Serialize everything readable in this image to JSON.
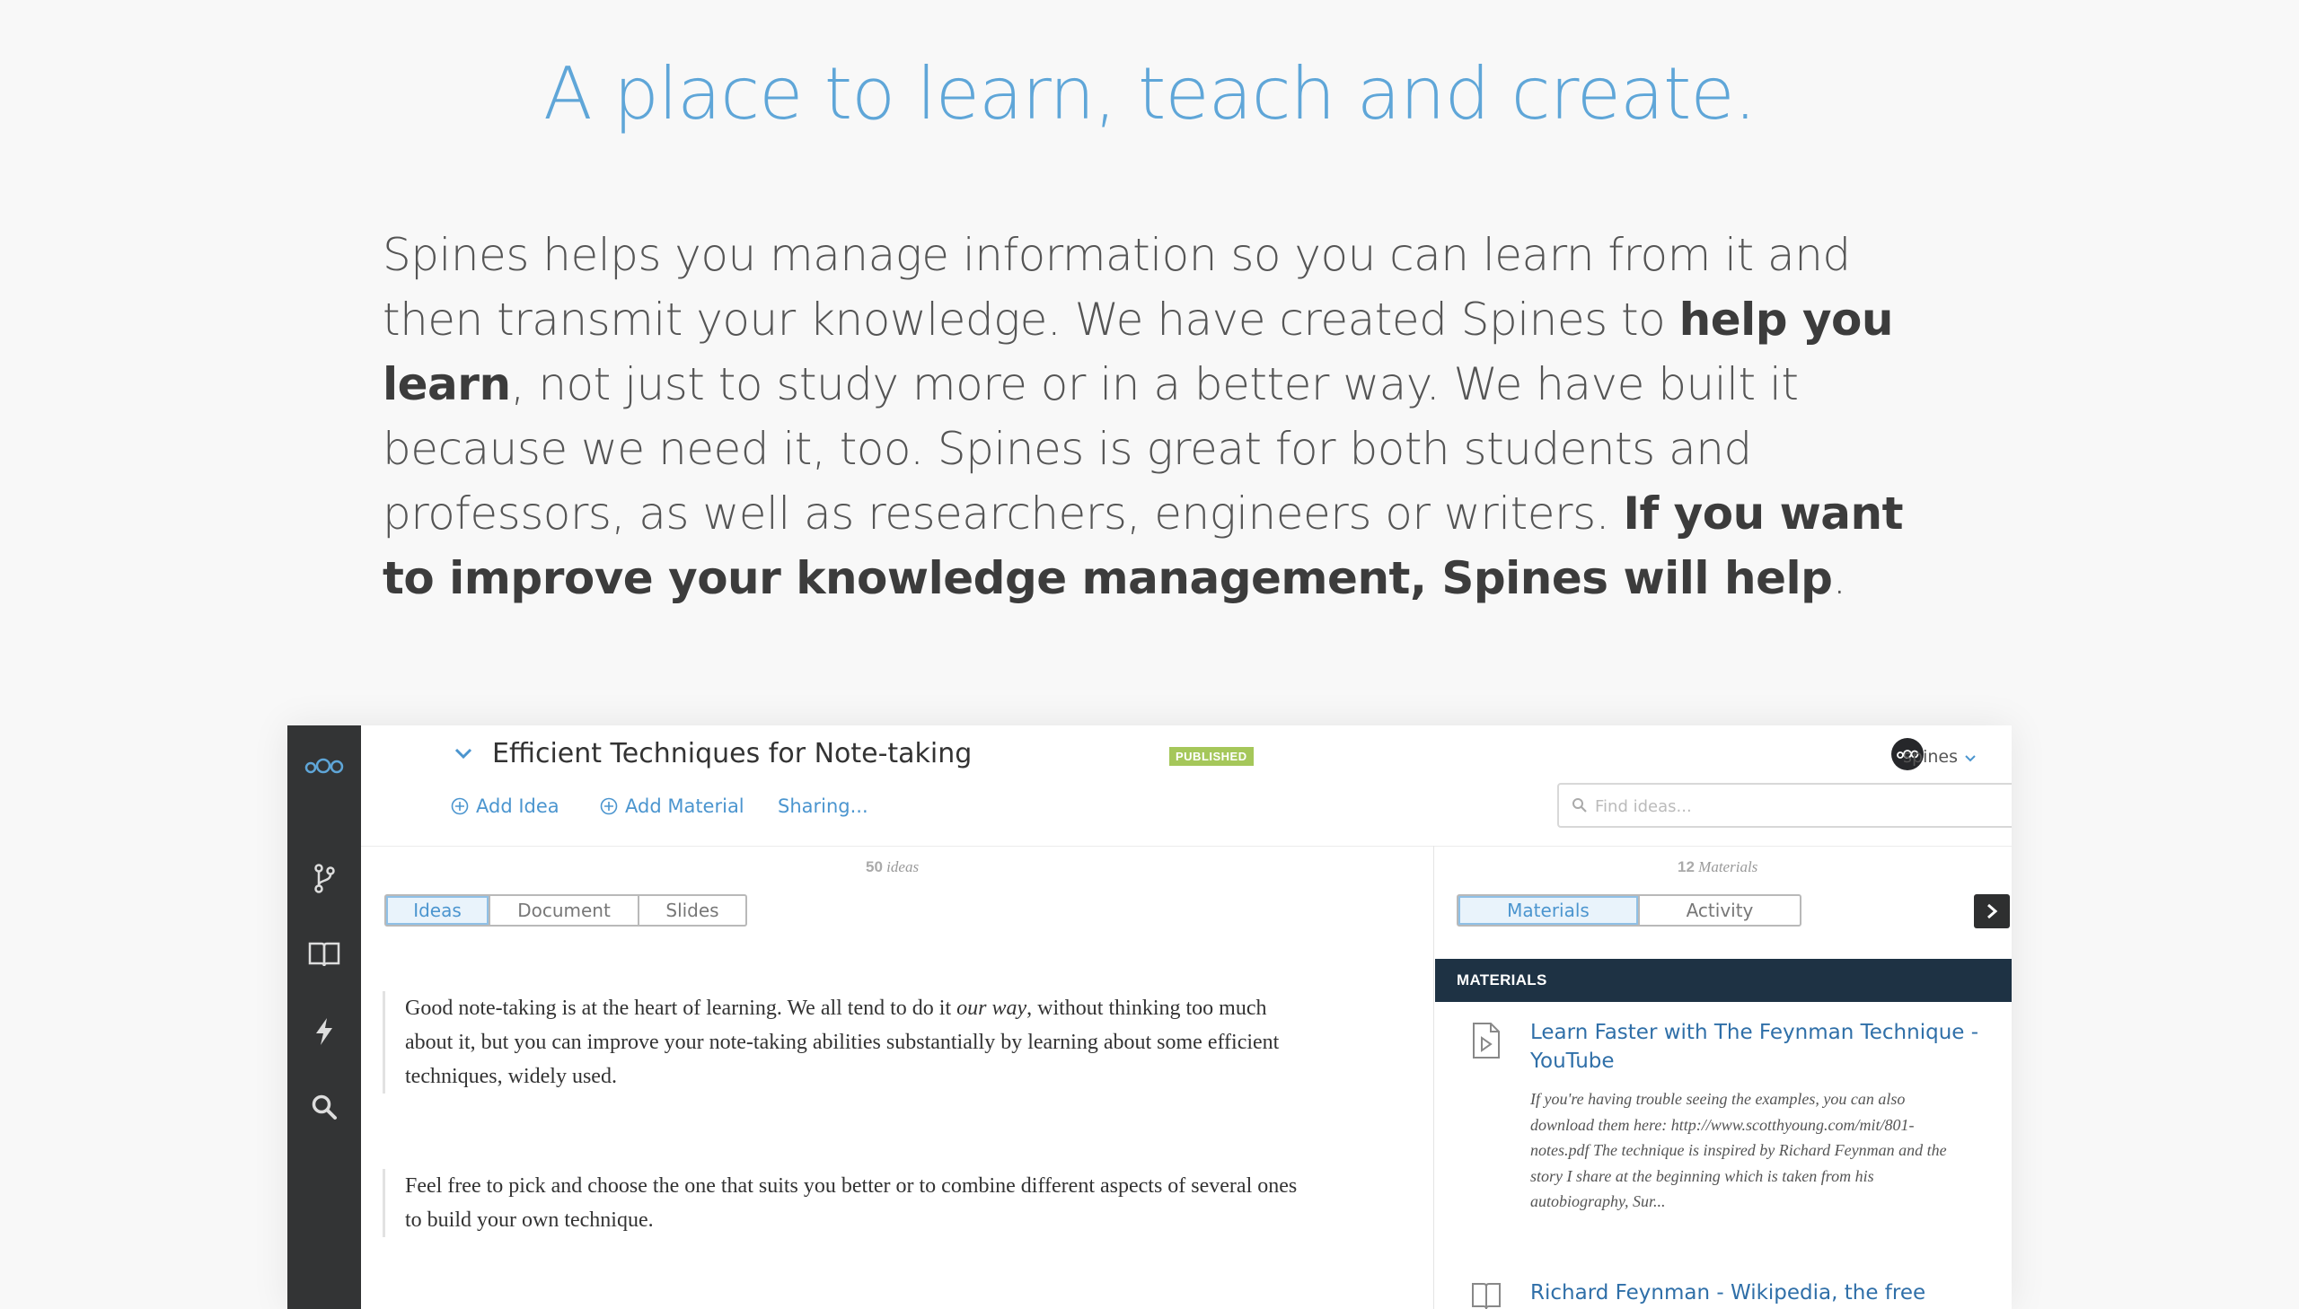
{
  "hero": {
    "headline": "A place to learn, teach and create.",
    "intro_1": "Spines helps you manage information so you can learn from it and then transmit your knowledge. We have created Spines to ",
    "intro_bold_1": "help you learn",
    "intro_2": ", not just to study more or in a better way. We have built it because we need it, too. Spines is great for both students and professors, as well as researchers, engineers or writers. ",
    "intro_bold_2": "If you want to improve your knowledge management, Spines will help",
    "intro_3": "."
  },
  "app": {
    "sidebar": {
      "icons": [
        "spines-logo-icon",
        "branch-icon",
        "book-icon",
        "bolt-icon",
        "search-icon"
      ]
    },
    "header": {
      "title": "Efficient Techniques for Note-taking",
      "badge": "PUBLISHED",
      "user_name": "spines"
    },
    "actions": {
      "add_idea": "Add Idea",
      "add_material": "Add Material",
      "sharing": "Sharing..."
    },
    "search": {
      "placeholder": "Find ideas..."
    },
    "ideas_panel": {
      "count_number": "50",
      "count_unit": "ideas",
      "tabs": [
        "Ideas",
        "Document",
        "Slides"
      ],
      "active_tab": "Ideas",
      "idea_1_a": "Good note-taking is at the heart of learning. We all tend to do it ",
      "idea_1_em": "our way",
      "idea_1_b": ", without thinking too much about it, but you can improve your note-taking abilities substantially by learning about some efficient techniques, widely used.",
      "idea_2": "Feel free to pick and choose the one that suits you better or to combine different aspects of several ones to build your own technique."
    },
    "materials_panel": {
      "count_number": "12",
      "count_unit": "Materials",
      "tabs": [
        "Materials",
        "Activity"
      ],
      "active_tab": "Materials",
      "header": "MATERIALS",
      "items": [
        {
          "title": "Learn Faster with The Feynman Technique - YouTube",
          "description": "If you're having trouble seeing the examples, you can also download them here: http://www.scotthyoung.com/mit/801-notes.pdf The technique is inspired by Richard Feynman and the story I share at the beginning which is taken from his autobiography, Sur..."
        },
        {
          "title": "Richard Feynman - Wikipedia, the free"
        }
      ]
    },
    "colors": {
      "accent": "#4b95cf",
      "headline": "#5fa6d8",
      "sidebar": "#333435",
      "badge": "#a5c75a",
      "materials_header": "#1e3244"
    }
  }
}
